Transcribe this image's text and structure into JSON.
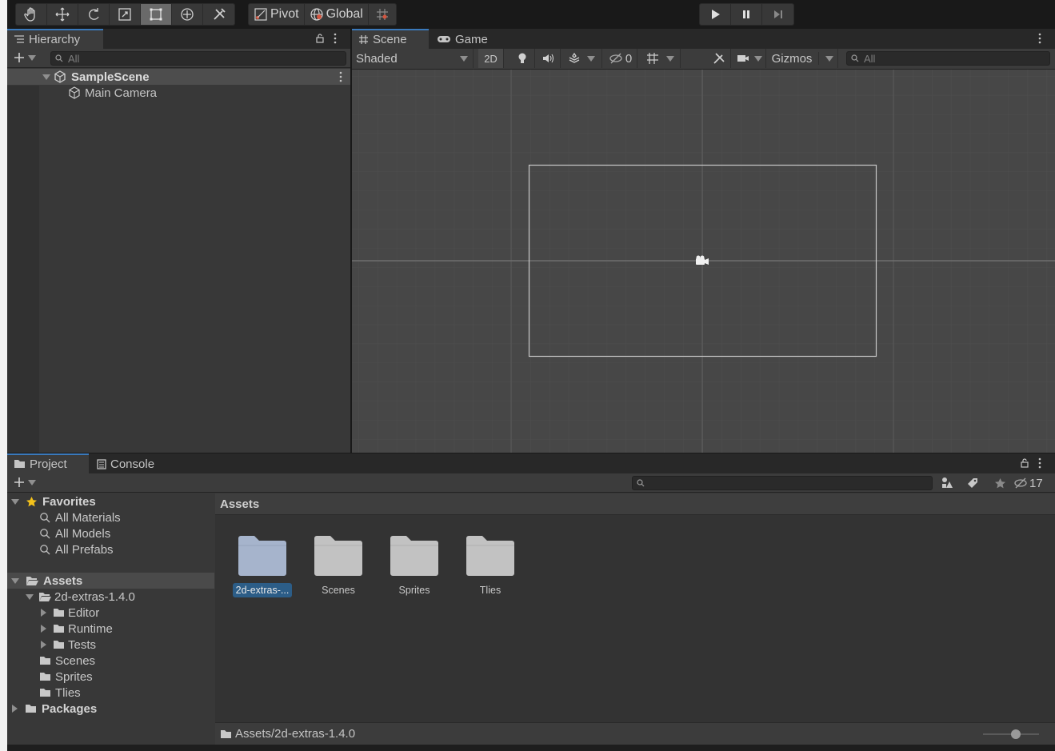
{
  "toolbar": {
    "tools": [
      "hand-tool",
      "move-tool",
      "rotate-tool",
      "scale-tool",
      "rect-tool",
      "transform-tool",
      "custom-tool"
    ],
    "active_tool": "rect-tool",
    "pivot_label": "Pivot",
    "global_label": "Global"
  },
  "hierarchy": {
    "tab_label": "Hierarchy",
    "search_placeholder": "All",
    "scene_name": "SampleScene",
    "items": [
      "Main Camera"
    ]
  },
  "scene_view": {
    "tabs": [
      "Scene",
      "Game"
    ],
    "shading_mode": "Shaded",
    "mode_2d_label": "2D",
    "hidden_count": "0",
    "gizmos_label": "Gizmos",
    "search_placeholder": "All"
  },
  "project": {
    "tabs": [
      "Project",
      "Console"
    ],
    "hidden_count": "17",
    "favorites": {
      "label": "Favorites",
      "items": [
        "All Materials",
        "All Models",
        "All Prefabs"
      ]
    },
    "tree": {
      "assets_label": "Assets",
      "extras_label": "2d-extras-1.4.0",
      "extras_children": [
        "Editor",
        "Runtime",
        "Tests"
      ],
      "asset_folders": [
        "Scenes",
        "Sprites",
        "Tlies"
      ],
      "packages_label": "Packages"
    },
    "grid_title": "Assets",
    "grid_items": [
      {
        "label": "2d-extras-...",
        "selected": true
      },
      {
        "label": "Scenes",
        "selected": false
      },
      {
        "label": "Sprites",
        "selected": false
      },
      {
        "label": "Tlies",
        "selected": false
      }
    ],
    "path": "Assets/2d-extras-1.4.0"
  },
  "colors": {
    "accent": "#3a79bb",
    "selection": "#2c5d87",
    "panel": "#383838",
    "viewport": "#474747"
  }
}
